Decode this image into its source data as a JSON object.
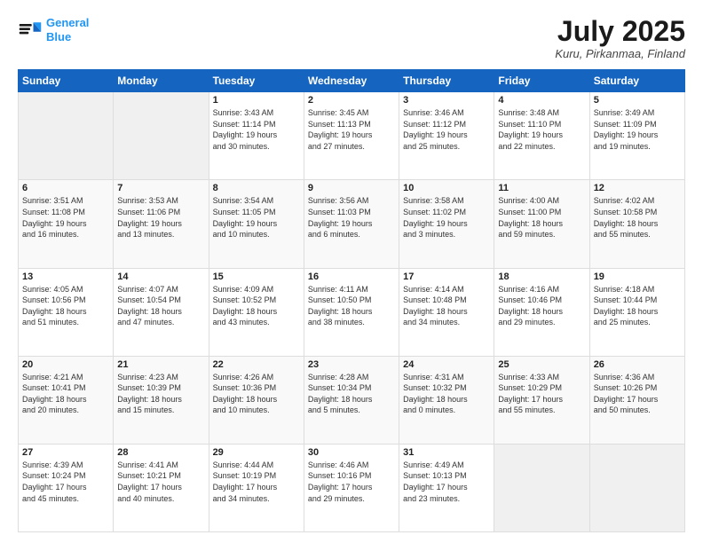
{
  "header": {
    "logo_line1": "General",
    "logo_line2": "Blue",
    "title": "July 2025",
    "subtitle": "Kuru, Pirkanmaa, Finland"
  },
  "weekdays": [
    "Sunday",
    "Monday",
    "Tuesday",
    "Wednesday",
    "Thursday",
    "Friday",
    "Saturday"
  ],
  "weeks": [
    [
      {
        "day": "",
        "info": ""
      },
      {
        "day": "",
        "info": ""
      },
      {
        "day": "1",
        "info": "Sunrise: 3:43 AM\nSunset: 11:14 PM\nDaylight: 19 hours\nand 30 minutes."
      },
      {
        "day": "2",
        "info": "Sunrise: 3:45 AM\nSunset: 11:13 PM\nDaylight: 19 hours\nand 27 minutes."
      },
      {
        "day": "3",
        "info": "Sunrise: 3:46 AM\nSunset: 11:12 PM\nDaylight: 19 hours\nand 25 minutes."
      },
      {
        "day": "4",
        "info": "Sunrise: 3:48 AM\nSunset: 11:10 PM\nDaylight: 19 hours\nand 22 minutes."
      },
      {
        "day": "5",
        "info": "Sunrise: 3:49 AM\nSunset: 11:09 PM\nDaylight: 19 hours\nand 19 minutes."
      }
    ],
    [
      {
        "day": "6",
        "info": "Sunrise: 3:51 AM\nSunset: 11:08 PM\nDaylight: 19 hours\nand 16 minutes."
      },
      {
        "day": "7",
        "info": "Sunrise: 3:53 AM\nSunset: 11:06 PM\nDaylight: 19 hours\nand 13 minutes."
      },
      {
        "day": "8",
        "info": "Sunrise: 3:54 AM\nSunset: 11:05 PM\nDaylight: 19 hours\nand 10 minutes."
      },
      {
        "day": "9",
        "info": "Sunrise: 3:56 AM\nSunset: 11:03 PM\nDaylight: 19 hours\nand 6 minutes."
      },
      {
        "day": "10",
        "info": "Sunrise: 3:58 AM\nSunset: 11:02 PM\nDaylight: 19 hours\nand 3 minutes."
      },
      {
        "day": "11",
        "info": "Sunrise: 4:00 AM\nSunset: 11:00 PM\nDaylight: 18 hours\nand 59 minutes."
      },
      {
        "day": "12",
        "info": "Sunrise: 4:02 AM\nSunset: 10:58 PM\nDaylight: 18 hours\nand 55 minutes."
      }
    ],
    [
      {
        "day": "13",
        "info": "Sunrise: 4:05 AM\nSunset: 10:56 PM\nDaylight: 18 hours\nand 51 minutes."
      },
      {
        "day": "14",
        "info": "Sunrise: 4:07 AM\nSunset: 10:54 PM\nDaylight: 18 hours\nand 47 minutes."
      },
      {
        "day": "15",
        "info": "Sunrise: 4:09 AM\nSunset: 10:52 PM\nDaylight: 18 hours\nand 43 minutes."
      },
      {
        "day": "16",
        "info": "Sunrise: 4:11 AM\nSunset: 10:50 PM\nDaylight: 18 hours\nand 38 minutes."
      },
      {
        "day": "17",
        "info": "Sunrise: 4:14 AM\nSunset: 10:48 PM\nDaylight: 18 hours\nand 34 minutes."
      },
      {
        "day": "18",
        "info": "Sunrise: 4:16 AM\nSunset: 10:46 PM\nDaylight: 18 hours\nand 29 minutes."
      },
      {
        "day": "19",
        "info": "Sunrise: 4:18 AM\nSunset: 10:44 PM\nDaylight: 18 hours\nand 25 minutes."
      }
    ],
    [
      {
        "day": "20",
        "info": "Sunrise: 4:21 AM\nSunset: 10:41 PM\nDaylight: 18 hours\nand 20 minutes."
      },
      {
        "day": "21",
        "info": "Sunrise: 4:23 AM\nSunset: 10:39 PM\nDaylight: 18 hours\nand 15 minutes."
      },
      {
        "day": "22",
        "info": "Sunrise: 4:26 AM\nSunset: 10:36 PM\nDaylight: 18 hours\nand 10 minutes."
      },
      {
        "day": "23",
        "info": "Sunrise: 4:28 AM\nSunset: 10:34 PM\nDaylight: 18 hours\nand 5 minutes."
      },
      {
        "day": "24",
        "info": "Sunrise: 4:31 AM\nSunset: 10:32 PM\nDaylight: 18 hours\nand 0 minutes."
      },
      {
        "day": "25",
        "info": "Sunrise: 4:33 AM\nSunset: 10:29 PM\nDaylight: 17 hours\nand 55 minutes."
      },
      {
        "day": "26",
        "info": "Sunrise: 4:36 AM\nSunset: 10:26 PM\nDaylight: 17 hours\nand 50 minutes."
      }
    ],
    [
      {
        "day": "27",
        "info": "Sunrise: 4:39 AM\nSunset: 10:24 PM\nDaylight: 17 hours\nand 45 minutes."
      },
      {
        "day": "28",
        "info": "Sunrise: 4:41 AM\nSunset: 10:21 PM\nDaylight: 17 hours\nand 40 minutes."
      },
      {
        "day": "29",
        "info": "Sunrise: 4:44 AM\nSunset: 10:19 PM\nDaylight: 17 hours\nand 34 minutes."
      },
      {
        "day": "30",
        "info": "Sunrise: 4:46 AM\nSunset: 10:16 PM\nDaylight: 17 hours\nand 29 minutes."
      },
      {
        "day": "31",
        "info": "Sunrise: 4:49 AM\nSunset: 10:13 PM\nDaylight: 17 hours\nand 23 minutes."
      },
      {
        "day": "",
        "info": ""
      },
      {
        "day": "",
        "info": ""
      }
    ]
  ]
}
